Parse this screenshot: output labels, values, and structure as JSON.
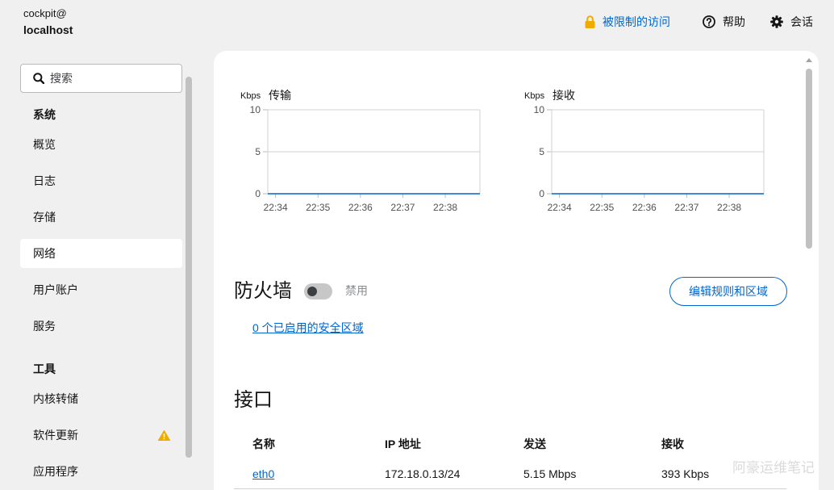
{
  "header": {
    "user_prefix": "cockpit@",
    "host": "localhost",
    "access": {
      "label": "被限制的访问",
      "icon": "lock-icon"
    },
    "help": {
      "label": "帮助",
      "icon": "help-icon"
    },
    "session": {
      "label": "会话",
      "icon": "gear-icon"
    }
  },
  "sidebar": {
    "search": {
      "placeholder": "搜索",
      "value": "",
      "icon": "search-icon"
    },
    "groups": [
      {
        "title": "系统",
        "items": [
          {
            "label": "概览"
          },
          {
            "label": "日志"
          },
          {
            "label": "存储"
          },
          {
            "label": "网络",
            "active": true
          },
          {
            "label": "用户账户"
          },
          {
            "label": "服务"
          }
        ]
      },
      {
        "title": "工具",
        "items": [
          {
            "label": "内核转储"
          },
          {
            "label": "软件更新",
            "badge": "warning-icon"
          },
          {
            "label": "应用程序"
          }
        ]
      }
    ]
  },
  "firewall": {
    "title": "防火墙",
    "enabled": false,
    "status": "禁用",
    "edit_button": "编辑规则和区域",
    "zones_link": "0 个已启用的安全区域"
  },
  "interfaces": {
    "title": "接口",
    "columns": [
      "名称",
      "IP 地址",
      "发送",
      "接收"
    ],
    "rows": [
      {
        "name": "eth0",
        "ip": "172.18.0.13/24",
        "sending": "5.15 Mbps",
        "receiving": "393 Kbps"
      }
    ]
  },
  "watermark": "阿豪运维笔记",
  "colors": {
    "accent": "#0066cc",
    "warning": "#f0ab00",
    "background": "#f0f0f0",
    "card": "#ffffff"
  },
  "chart_data": [
    {
      "type": "line",
      "title": "传输",
      "ylabel": "Kbps",
      "ylim": [
        0,
        10
      ],
      "yticks": [
        10,
        5,
        0
      ],
      "xlim": [
        "22:33:49",
        "22:38:49"
      ],
      "xticks": [
        "22:34",
        "22:35",
        "22:36",
        "22:37",
        "22:38"
      ],
      "grid": true,
      "series": [
        {
          "x": [
            "22:33:49",
            "22:34",
            "22:35",
            "22:36",
            "22:37",
            "22:38",
            "22:38:49"
          ],
          "values": [
            0,
            0,
            0,
            0,
            0,
            0,
            0
          ],
          "color": "#0066cc"
        }
      ]
    },
    {
      "type": "line",
      "title": "接收",
      "ylabel": "Kbps",
      "ylim": [
        0,
        10
      ],
      "yticks": [
        10,
        5,
        0
      ],
      "xlim": [
        "22:33:49",
        "22:38:49"
      ],
      "xticks": [
        "22:34",
        "22:35",
        "22:36",
        "22:37",
        "22:38"
      ],
      "grid": true,
      "series": [
        {
          "x": [
            "22:33:49",
            "22:34",
            "22:35",
            "22:36",
            "22:37",
            "22:38",
            "22:38:49"
          ],
          "values": [
            0,
            0,
            0,
            0,
            0,
            0,
            0
          ],
          "color": "#0066cc"
        }
      ]
    }
  ]
}
